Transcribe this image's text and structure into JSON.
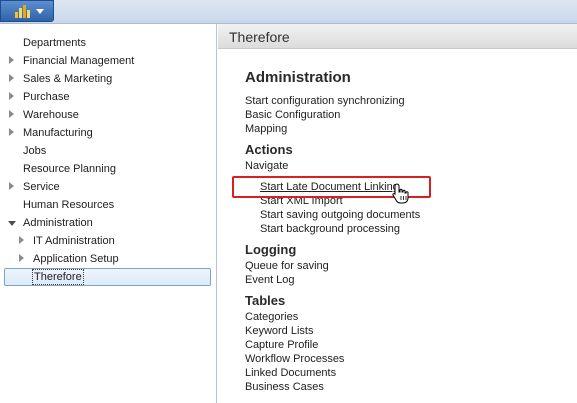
{
  "app": {
    "logo_icon": "therefore-logo-icon",
    "menu_icon": "chevron-down-icon"
  },
  "nav": {
    "items": [
      {
        "label": "Departments",
        "expander": "none"
      },
      {
        "label": "Financial Management",
        "expander": "collapsed"
      },
      {
        "label": "Sales & Marketing",
        "expander": "collapsed"
      },
      {
        "label": "Purchase",
        "expander": "collapsed"
      },
      {
        "label": "Warehouse",
        "expander": "collapsed"
      },
      {
        "label": "Manufacturing",
        "expander": "collapsed"
      },
      {
        "label": "Jobs",
        "expander": "none"
      },
      {
        "label": "Resource Planning",
        "expander": "none"
      },
      {
        "label": "Service",
        "expander": "collapsed"
      },
      {
        "label": "Human Resources",
        "expander": "none"
      },
      {
        "label": "Administration",
        "expander": "expanded"
      },
      {
        "label": "IT Administration",
        "expander": "collapsed"
      },
      {
        "label": "Application Setup",
        "expander": "collapsed"
      },
      {
        "label": "Therefore",
        "expander": "none",
        "selected": true
      }
    ]
  },
  "content": {
    "header": "Therefore",
    "administration": {
      "title": "Administration",
      "links": [
        "Start configuration synchronizing",
        "Basic Configuration",
        "Mapping"
      ]
    },
    "actions": {
      "title": "Actions",
      "navigate": "Navigate",
      "links": [
        "Start Late Document Linking",
        "Start XML Import",
        "Start saving outgoing documents",
        "Start background processing"
      ]
    },
    "logging": {
      "title": "Logging",
      "links": [
        "Queue for saving",
        "Event Log"
      ]
    },
    "tables": {
      "title": "Tables",
      "links": [
        "Categories",
        "Keyword Lists",
        "Capture Profile",
        "Workflow Processes",
        "Linked Documents",
        "Business Cases"
      ]
    }
  },
  "colors": {
    "highlight": "#d72020",
    "app_button": "#2f62a8",
    "selection_border": "#7da2ce"
  }
}
